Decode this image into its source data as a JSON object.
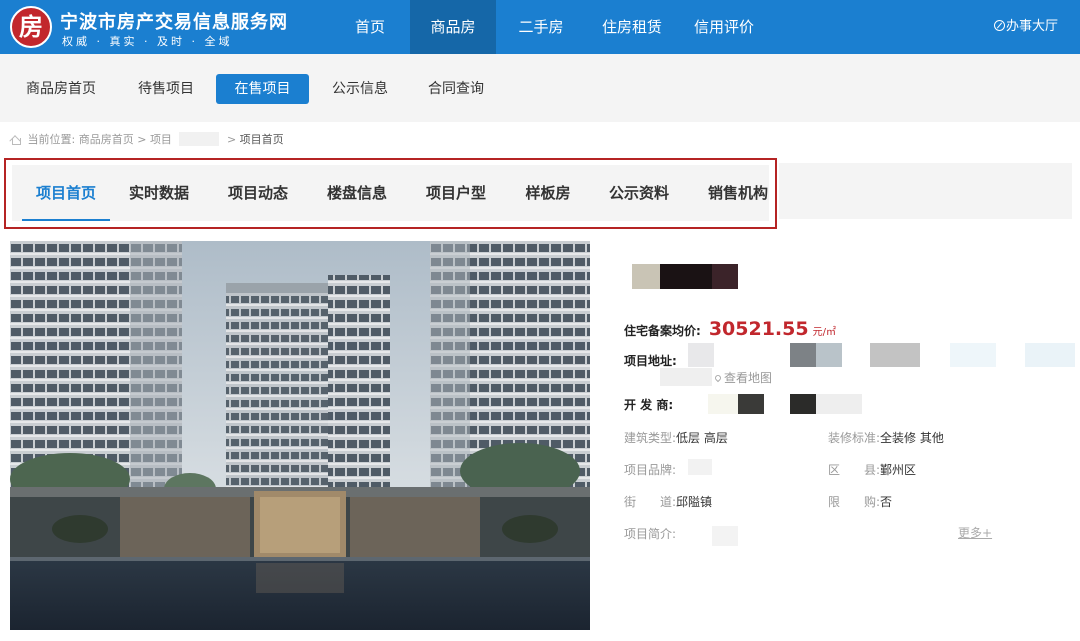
{
  "header": {
    "logo_glyph": "房",
    "site_title": "宁波市房产交易信息服务网",
    "slogan": "权威 · 真实 · 及时 · 全域",
    "nav": [
      {
        "label": "首页"
      },
      {
        "label": "商品房",
        "active": true
      },
      {
        "label": "二手房"
      },
      {
        "label": "住房租赁"
      },
      {
        "label": "信用评价"
      }
    ],
    "office_label": "办事大厅"
  },
  "subnav": {
    "items": [
      {
        "label": "商品房首页"
      },
      {
        "label": "待售项目"
      },
      {
        "label": "在售项目",
        "active": true
      },
      {
        "label": "公示信息"
      },
      {
        "label": "合同查询"
      }
    ]
  },
  "breadcrumb": {
    "prefix": "当前位置:",
    "home": "商品房首页",
    "sep": ">",
    "project": "项目",
    "current": "项目首页"
  },
  "tabs": [
    {
      "label": "项目首页",
      "active": true
    },
    {
      "label": "实时数据"
    },
    {
      "label": "项目动态"
    },
    {
      "label": "楼盘信息"
    },
    {
      "label": "项目户型"
    },
    {
      "label": "样板房"
    },
    {
      "label": "公示资料"
    },
    {
      "label": "销售机构"
    }
  ],
  "project": {
    "price_label": "住宅备案均价:",
    "price_value": "30521.55",
    "price_unit": "元/㎡",
    "address_label": "项目地址:",
    "map_link": "查看地图",
    "developer_label": "开 发 商:",
    "details": {
      "building_type_label": "建筑类型:",
      "building_type_value": "低层 高层",
      "decoration_label": "装修标准:",
      "decoration_value": "全装修 其他",
      "brand_label": "项目品牌:",
      "district_label": "区　　县:",
      "district_value": "鄞州区",
      "street_label": "街　　道:",
      "street_value": "邱隘镇",
      "purchase_limit_label": "限　　购:",
      "purchase_limit_value": "否",
      "intro_label": "项目简介:"
    },
    "more_link": "更多+"
  },
  "colors": {
    "header_blue": "#1b7fd0",
    "header_active": "#1567a8",
    "price_red": "#c1272d",
    "highlight_border": "#b52424"
  }
}
